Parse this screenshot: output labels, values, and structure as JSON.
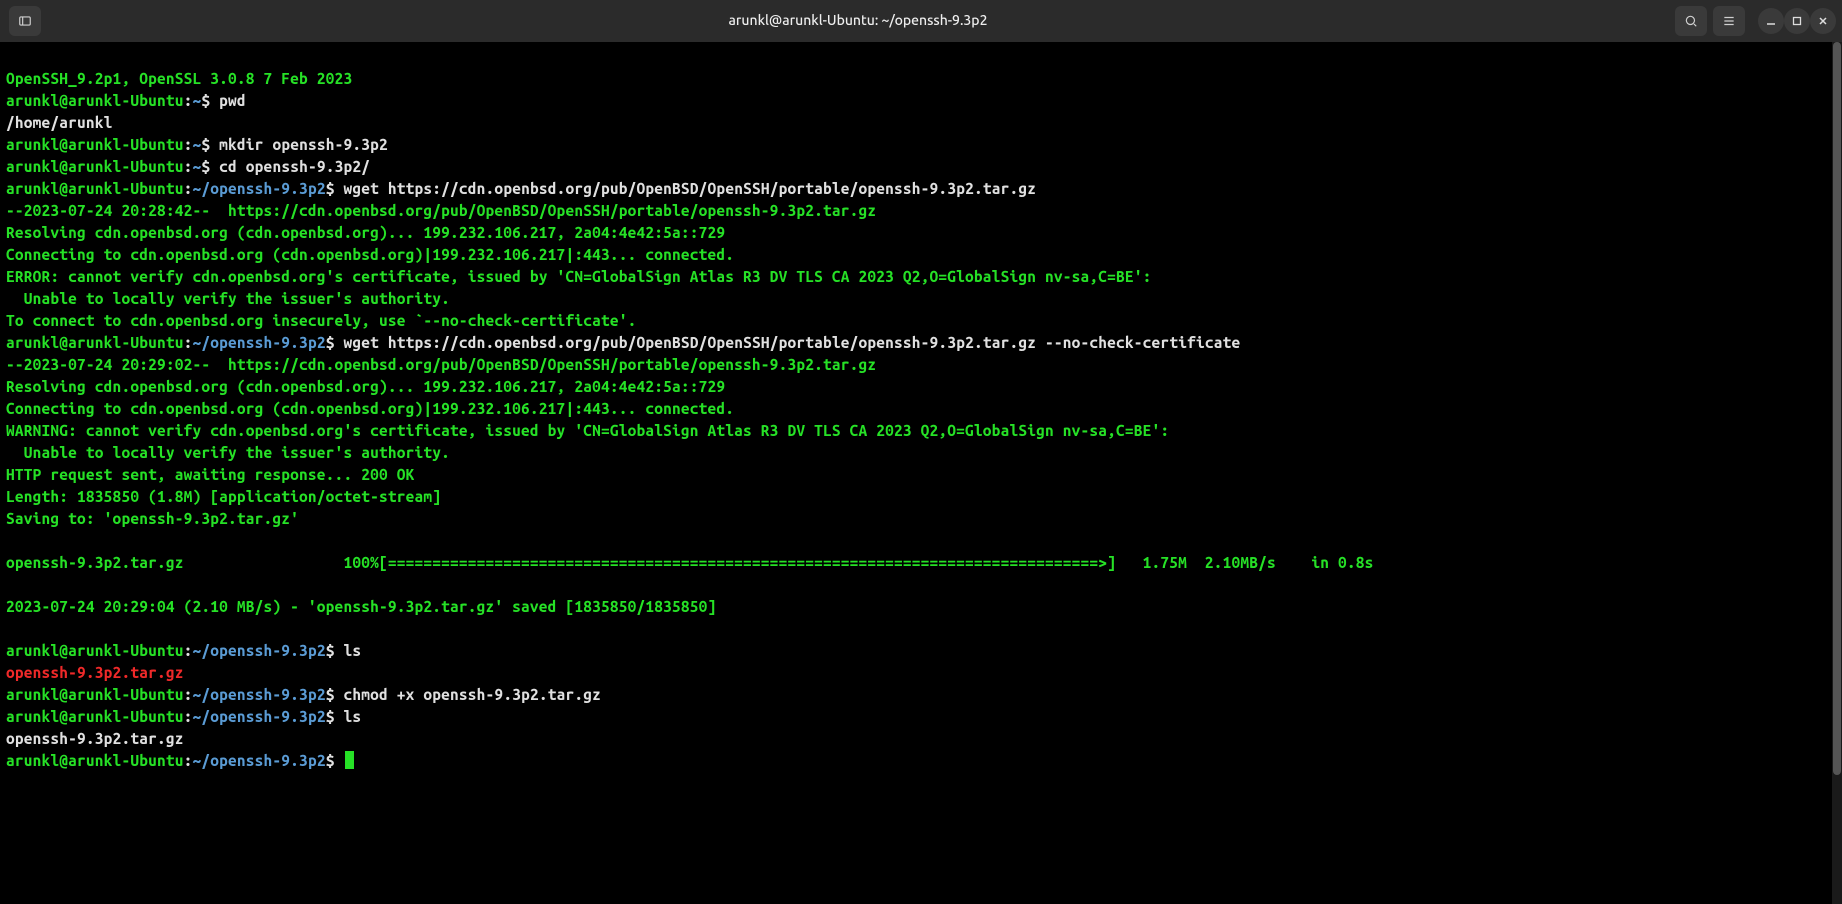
{
  "titlebar": {
    "title": "arunkl@arunkl-Ubuntu: ~/openssh-9.3p2"
  },
  "prompt": {
    "user_host": "arunkl@arunkl-Ubuntu",
    "home": "~",
    "cwd": "~/openssh-9.3p2",
    "sep": ":",
    "sigil": "$"
  },
  "lines": {
    "l1": "OpenSSH_9.2p1, OpenSSL 3.0.8 7 Feb 2023",
    "cmd_pwd": " pwd",
    "l3": "/home/arunkl",
    "cmd_mkdir": " mkdir openssh-9.3p2",
    "cmd_cd": " cd openssh-9.3p2/",
    "cmd_wget1": " wget https://cdn.openbsd.org/pub/OpenBSD/OpenSSH/portable/openssh-9.3p2.tar.gz",
    "l7": "--2023-07-24 20:28:42--  https://cdn.openbsd.org/pub/OpenBSD/OpenSSH/portable/openssh-9.3p2.tar.gz",
    "l8": "Resolving cdn.openbsd.org (cdn.openbsd.org)... 199.232.106.217, 2a04:4e42:5a::729",
    "l9": "Connecting to cdn.openbsd.org (cdn.openbsd.org)|199.232.106.217|:443... connected.",
    "l10": "ERROR: cannot verify cdn.openbsd.org's certificate, issued by 'CN=GlobalSign Atlas R3 DV TLS CA 2023 Q2,O=GlobalSign nv-sa,C=BE':",
    "l11": "  Unable to locally verify the issuer's authority.",
    "l12": "To connect to cdn.openbsd.org insecurely, use `--no-check-certificate'.",
    "cmd_wget2": " wget https://cdn.openbsd.org/pub/OpenBSD/OpenSSH/portable/openssh-9.3p2.tar.gz --no-check-certificate",
    "l14": "--2023-07-24 20:29:02--  https://cdn.openbsd.org/pub/OpenBSD/OpenSSH/portable/openssh-9.3p2.tar.gz",
    "l15": "Resolving cdn.openbsd.org (cdn.openbsd.org)... 199.232.106.217, 2a04:4e42:5a::729",
    "l16": "Connecting to cdn.openbsd.org (cdn.openbsd.org)|199.232.106.217|:443... connected.",
    "l17": "WARNING: cannot verify cdn.openbsd.org's certificate, issued by 'CN=GlobalSign Atlas R3 DV TLS CA 2023 Q2,O=GlobalSign nv-sa,C=BE':",
    "l18": "  Unable to locally verify the issuer's authority.",
    "l19": "HTTP request sent, awaiting response... 200 OK",
    "l20": "Length: 1835850 (1.8M) [application/octet-stream]",
    "l21": "Saving to: 'openssh-9.3p2.tar.gz'",
    "blank": " ",
    "l22": "openssh-9.3p2.tar.gz                  100%[================================================================================>]   1.75M  2.10MB/s    in 0.8s",
    "l23": "2023-07-24 20:29:04 (2.10 MB/s) - 'openssh-9.3p2.tar.gz' saved [1835850/1835850]",
    "cmd_ls1": " ls",
    "l_red": "openssh-9.3p2.tar.gz",
    "cmd_chmod": " chmod +x openssh-9.3p2.tar.gz",
    "cmd_ls2": " ls",
    "l_plain_tgz": "openssh-9.3p2.tar.gz"
  }
}
